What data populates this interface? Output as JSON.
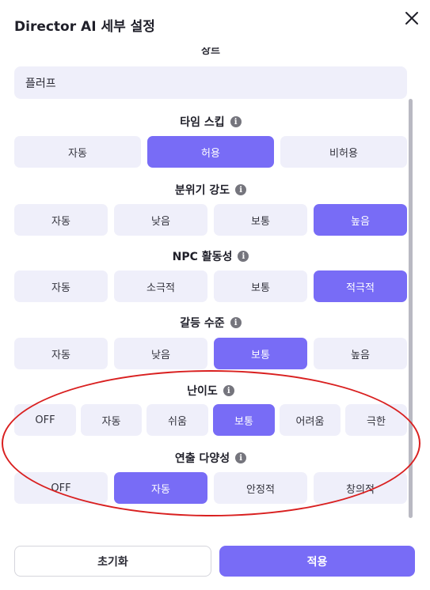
{
  "dialog": {
    "title": "Director AI 세부 설정",
    "close_icon": "close-icon"
  },
  "clipped_label": "장르",
  "genre_input": {
    "value": "플러프"
  },
  "sections": {
    "time_skip": {
      "label": "타임 스킵",
      "options": [
        "자동",
        "허용",
        "비허용"
      ],
      "selected": "허용"
    },
    "mood_intensity": {
      "label": "분위기 강도",
      "options": [
        "자동",
        "낮음",
        "보통",
        "높음"
      ],
      "selected": "높음"
    },
    "npc_activity": {
      "label": "NPC 활동성",
      "options": [
        "자동",
        "소극적",
        "보통",
        "적극적"
      ],
      "selected": "적극적"
    },
    "conflict_level": {
      "label": "갈등 수준",
      "options": [
        "자동",
        "낮음",
        "보통",
        "높음"
      ],
      "selected": "보통"
    },
    "difficulty": {
      "label": "난이도",
      "options": [
        "OFF",
        "자동",
        "쉬움",
        "보통",
        "어려움",
        "극한"
      ],
      "selected": "보통"
    },
    "directing_variety": {
      "label": "연출 다양성",
      "options": [
        "OFF",
        "자동",
        "안정적",
        "창의적"
      ],
      "selected": "자동"
    }
  },
  "footer": {
    "reset_label": "초기화",
    "apply_label": "적용"
  },
  "colors": {
    "accent": "#786cf6",
    "option_bg": "#efeffa",
    "annotation": "#d92020"
  }
}
